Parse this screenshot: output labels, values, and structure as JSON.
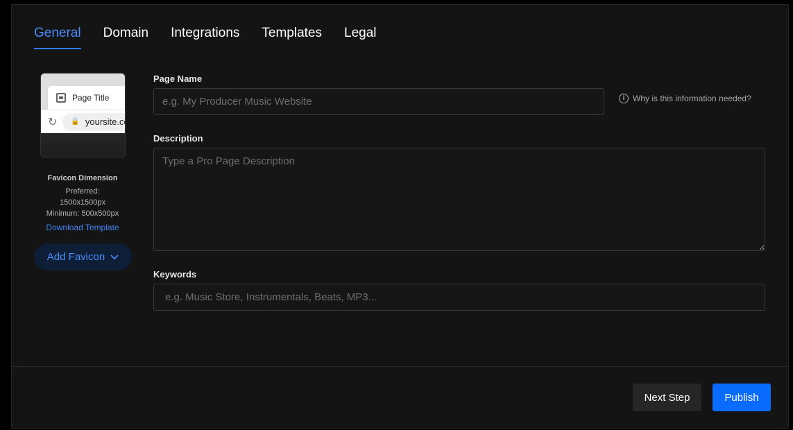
{
  "tabs": [
    {
      "label": "General",
      "active": true
    },
    {
      "label": "Domain"
    },
    {
      "label": "Integrations"
    },
    {
      "label": "Templates"
    },
    {
      "label": "Legal"
    }
  ],
  "favicon": {
    "preview_tab_title": "Page Title",
    "preview_url": "yoursite.com",
    "dimension_title": "Favicon Dimension",
    "preferred_label": "Preferred:",
    "preferred_value": "1500x1500px",
    "minimum": "Minimum: 500x500px",
    "download_template": "Download Template",
    "add_button": "Add Favicon"
  },
  "form": {
    "page_name": {
      "label": "Page Name",
      "placeholder": "e.g. My Producer Music Website",
      "value": ""
    },
    "help_text": "Why is this information needed?",
    "description": {
      "label": "Description",
      "placeholder": "Type a Pro Page Description",
      "value": ""
    },
    "keywords": {
      "label": "Keywords",
      "placeholder": "e.g. Music Store, Instrumentals, Beats, MP3...",
      "value": ""
    }
  },
  "footer": {
    "next_step": "Next Step",
    "publish": "Publish"
  },
  "colors": {
    "accent": "#2f7bff",
    "publish_bg": "#0a6cff",
    "panel_bg": "#141414"
  }
}
